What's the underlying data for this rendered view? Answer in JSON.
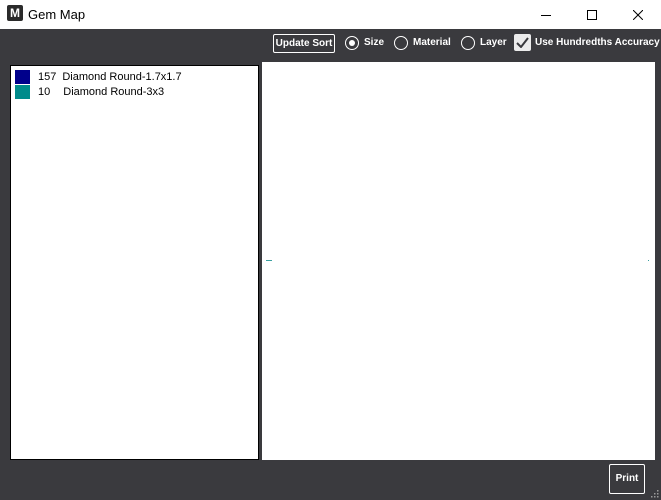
{
  "window": {
    "title": "Gem Map",
    "app_icon_letter": "M"
  },
  "toolbar": {
    "update_sort_label": "Update Sort",
    "sort_options": [
      {
        "label": "Size",
        "selected": true
      },
      {
        "label": "Material",
        "selected": false
      },
      {
        "label": "Layer",
        "selected": false
      }
    ],
    "hundredths_label": "Use Hundredths Accuracy",
    "hundredths_checked": true
  },
  "legend": {
    "items": [
      {
        "count": "157",
        "name": "Diamond Round-1.7x1.7",
        "color": "#00008b"
      },
      {
        "count": "10",
        "name": "Diamond Round-3x3",
        "color": "#008b8b"
      }
    ]
  },
  "footer": {
    "print_label": "Print"
  },
  "colors": {
    "background": "#3a3a3e",
    "panel": "#ffffff",
    "accent": "#ffffff"
  }
}
